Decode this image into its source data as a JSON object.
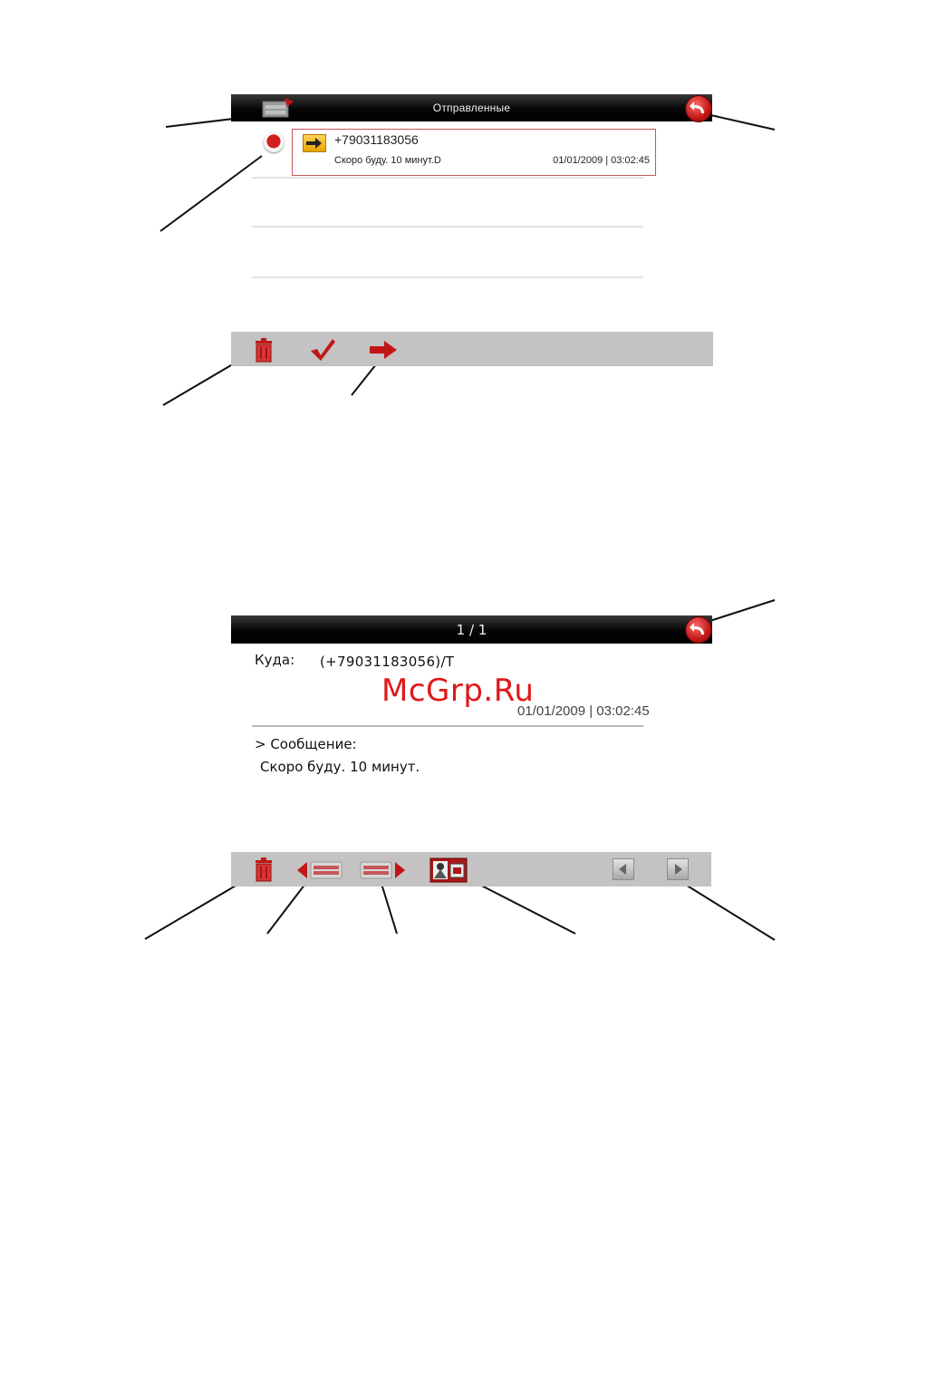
{
  "screen_sent_list": {
    "title": "Отправленные",
    "message": {
      "number": "+79031183056",
      "preview": "Скоро буду. 10 минут.D",
      "datetime": "01/01/2009 | 03:02:45"
    }
  },
  "screen_message_detail": {
    "title": "1 / 1",
    "to_label": "Куда:",
    "to_value": "(+79031183056)/T",
    "datetime": "01/01/2009 | 03:02:45",
    "message_heading": "> Сообщение:",
    "message_body": "Скоро буду. 10 минут."
  },
  "watermark": "McGrp.Ru",
  "colors": {
    "accent_red": "#c21616",
    "titlebar": "#000000",
    "toolbar": "#c4c2c2",
    "watermark": "#e01818"
  }
}
